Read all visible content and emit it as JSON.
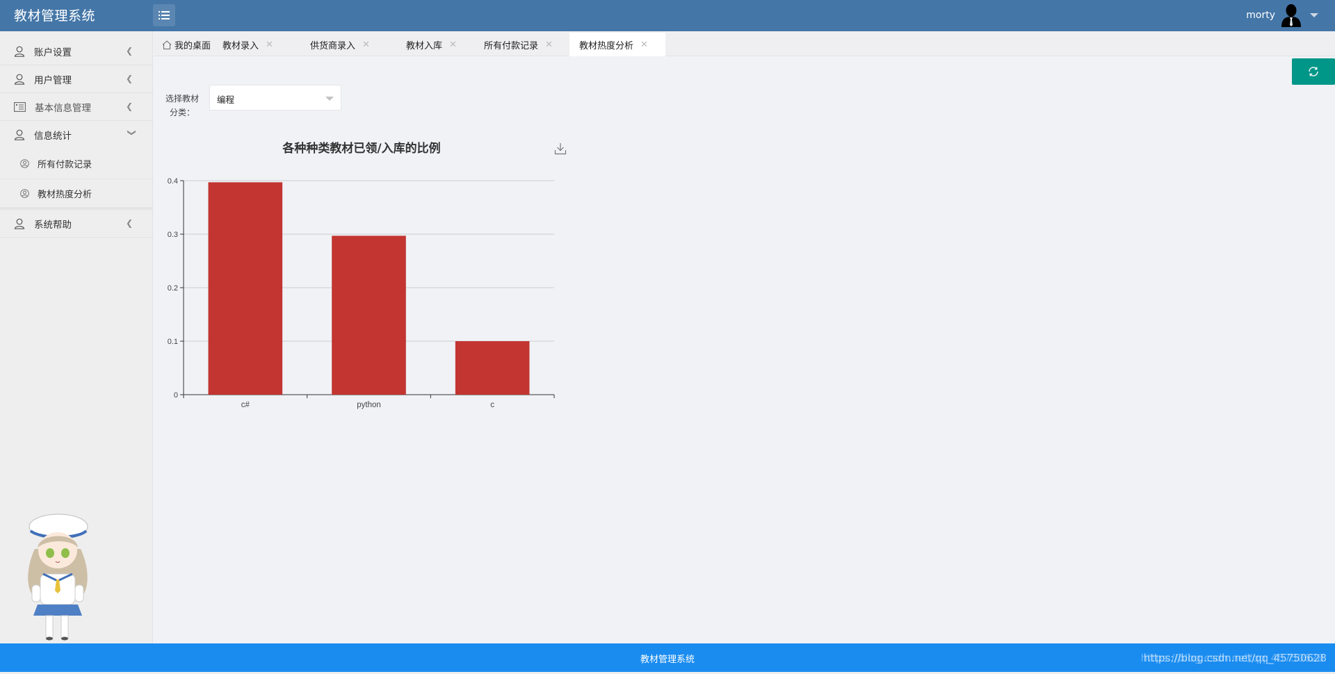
{
  "app": {
    "title": "教材管理系统"
  },
  "header": {
    "user_name": "morty"
  },
  "sidebar": {
    "items": [
      {
        "label": "账户设置",
        "icon": "user-icon",
        "expanded": false
      },
      {
        "label": "用户管理",
        "icon": "user-icon",
        "expanded": false
      },
      {
        "label": "基本信息管理",
        "icon": "id-card-icon",
        "expanded": false
      },
      {
        "label": "信息统计",
        "icon": "user-icon",
        "expanded": true,
        "children": [
          {
            "label": "所有付款记录",
            "icon": "user-circle-icon"
          },
          {
            "label": "教材热度分析",
            "icon": "user-circle-icon"
          }
        ]
      },
      {
        "label": "系统帮助",
        "icon": "user-icon",
        "expanded": false
      }
    ]
  },
  "tabs": [
    {
      "label": "我的桌面",
      "icon": "home-icon",
      "closable": false,
      "active": false
    },
    {
      "label": "教材录入",
      "closable": true,
      "active": false
    },
    {
      "label": "供货商录入",
      "closable": true,
      "active": false
    },
    {
      "label": "教材入库",
      "closable": true,
      "active": false
    },
    {
      "label": "所有付款记录",
      "closable": true,
      "active": false
    },
    {
      "label": "教材热度分析",
      "closable": true,
      "active": true
    }
  ],
  "close_glyph": "✕",
  "filter": {
    "label_line1": "选择教材",
    "label_line2": "分类：",
    "selected": "编程"
  },
  "chart_data": {
    "type": "bar",
    "title": "各种种类教材已领/入库的比例",
    "categories": [
      "c#",
      "python",
      "c"
    ],
    "values": [
      0.397,
      0.297,
      0.1
    ],
    "xlabel": "",
    "ylabel": "",
    "ylim": [
      0,
      0.4
    ],
    "yticks": [
      0,
      0.1,
      0.2,
      0.3,
      0.4
    ],
    "ytick_labels": [
      "0",
      "0.1",
      "0.2",
      "0.3",
      "0.4"
    ],
    "grid": true,
    "legend": "none",
    "bar_color": "#c23531"
  },
  "footer": {
    "text": "教材管理系统",
    "watermark": "https://blog.csdn.net/qq_45750628"
  },
  "colors": {
    "header": "#4476a7",
    "footer": "#1a8cf0",
    "refresh_button": "#009688"
  }
}
